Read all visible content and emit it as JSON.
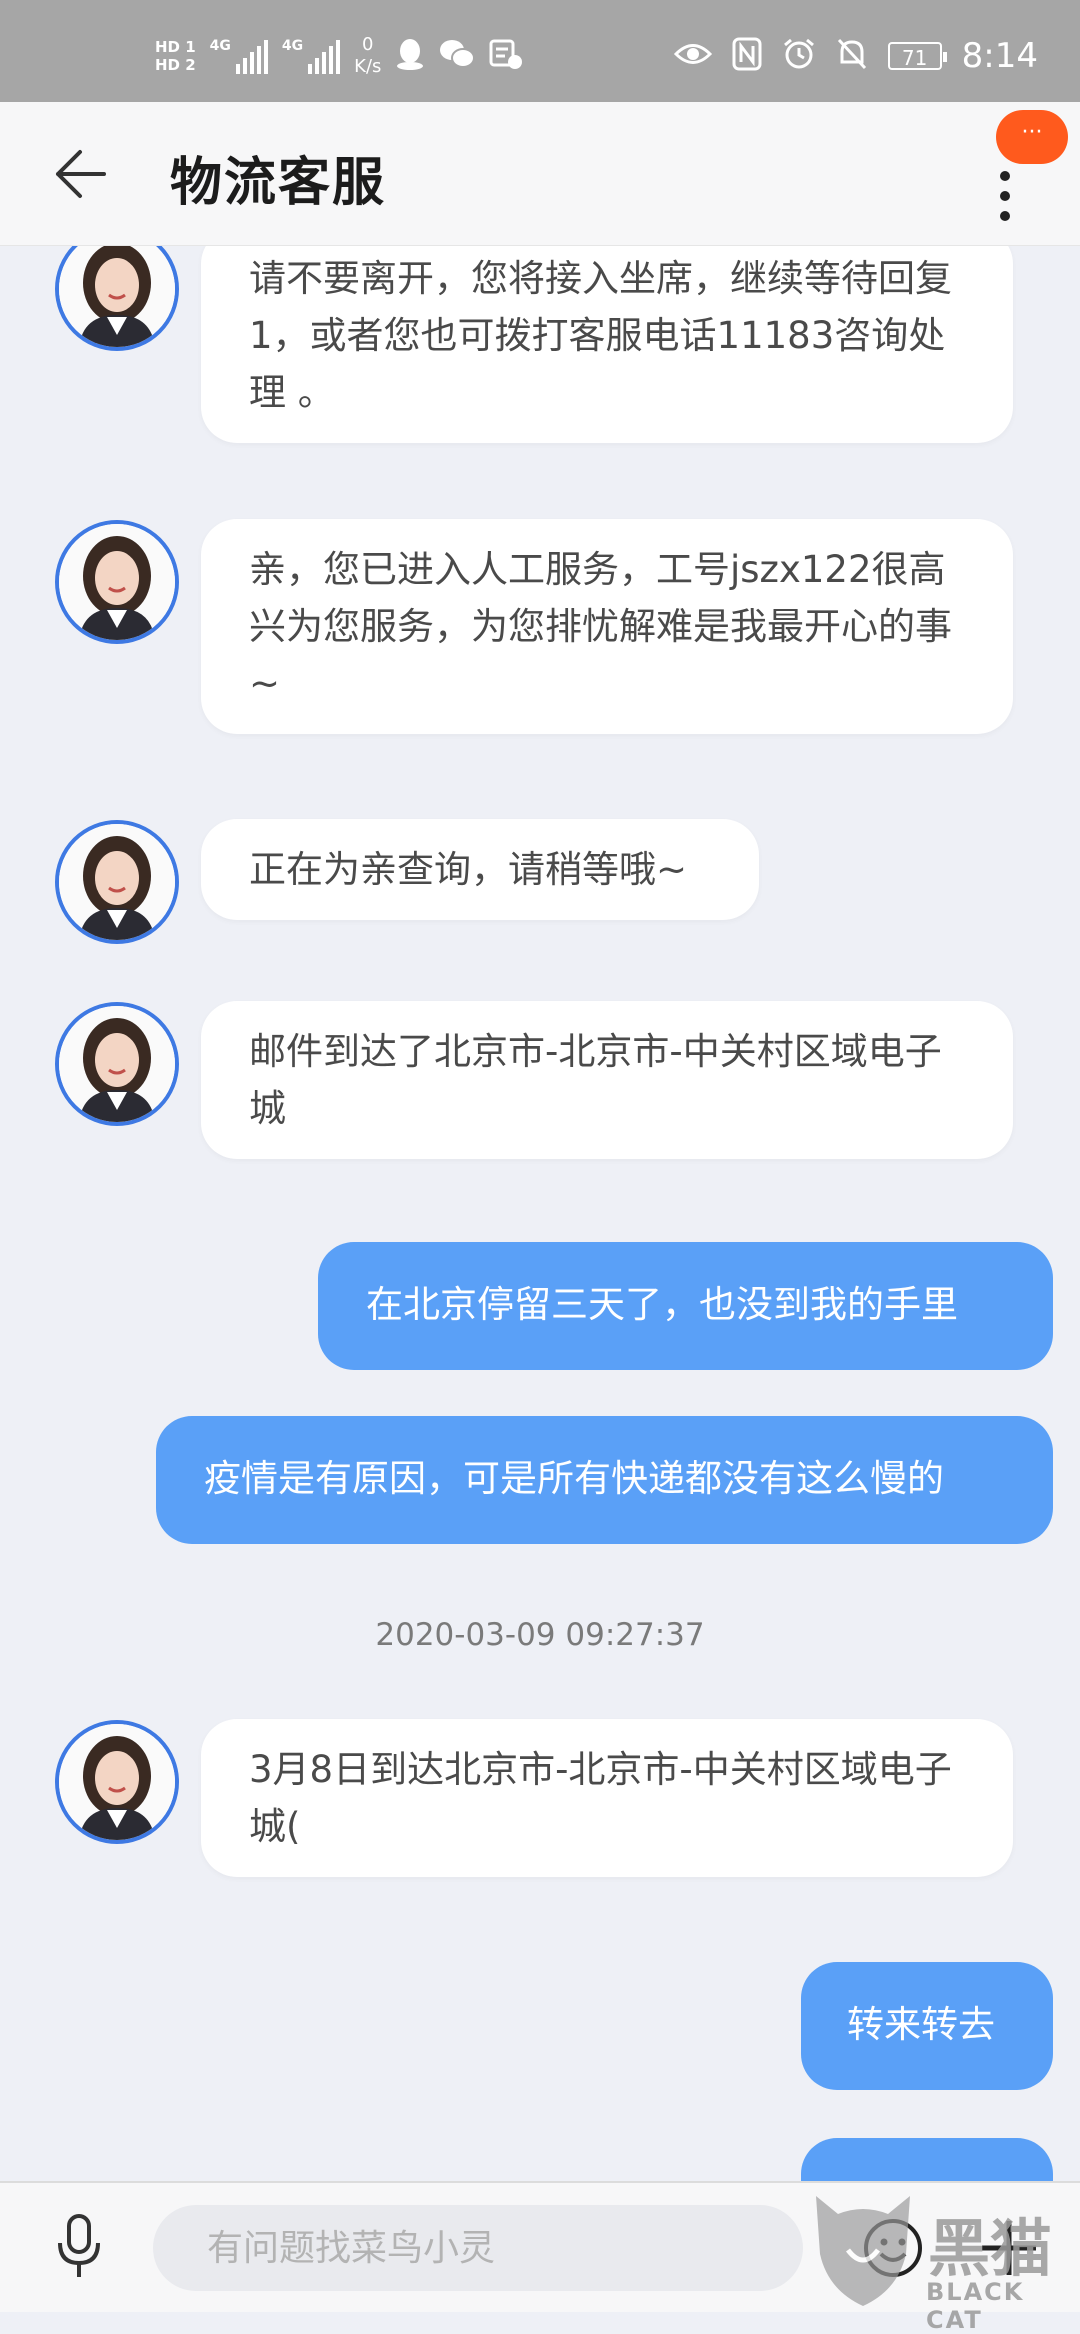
{
  "status_bar": {
    "hd1": "HD 1",
    "hd2": "HD 2",
    "net1": "4G",
    "net2": "4G",
    "speed_value": "0",
    "speed_unit": "K/s",
    "battery": "71",
    "time": "8:14"
  },
  "header": {
    "title": "物流客服",
    "more_badge": "···"
  },
  "messages": [
    {
      "side": "in",
      "text": "请不要离开，您将接入坐席，继续等待回复1，或者您也可拨打客服电话11183咨询处理 。"
    },
    {
      "side": "in",
      "text": "亲，您已进入人工服务，工号jszx122很高兴为您服务，为您排忧解难是我最开心的事~"
    },
    {
      "side": "in",
      "text": "正在为亲查询，请稍等哦~"
    },
    {
      "side": "in",
      "text": "邮件到达了北京市-北京市-中关村区域电子城"
    },
    {
      "side": "out",
      "text": "在北京停留三天了，也没到我的手里"
    },
    {
      "side": "out",
      "text": "疫情是有原因，可是所有快递都没有这么慢的"
    },
    {
      "side": "in",
      "text": "3月8日到达北京市-北京市-中关村区域电子城("
    },
    {
      "side": "out",
      "text": "转来转去"
    }
  ],
  "timestamp": "2020-03-09 09:27:37",
  "input": {
    "placeholder": "有问题找菜鸟小灵"
  },
  "watermark": {
    "cn": "黑猫",
    "en": "BLACK CAT"
  },
  "colors": {
    "accent_blue": "#5aa0f7",
    "avatar_border": "#3e79e3",
    "badge_orange": "#ff5a1d",
    "background": "#eef0f6"
  }
}
